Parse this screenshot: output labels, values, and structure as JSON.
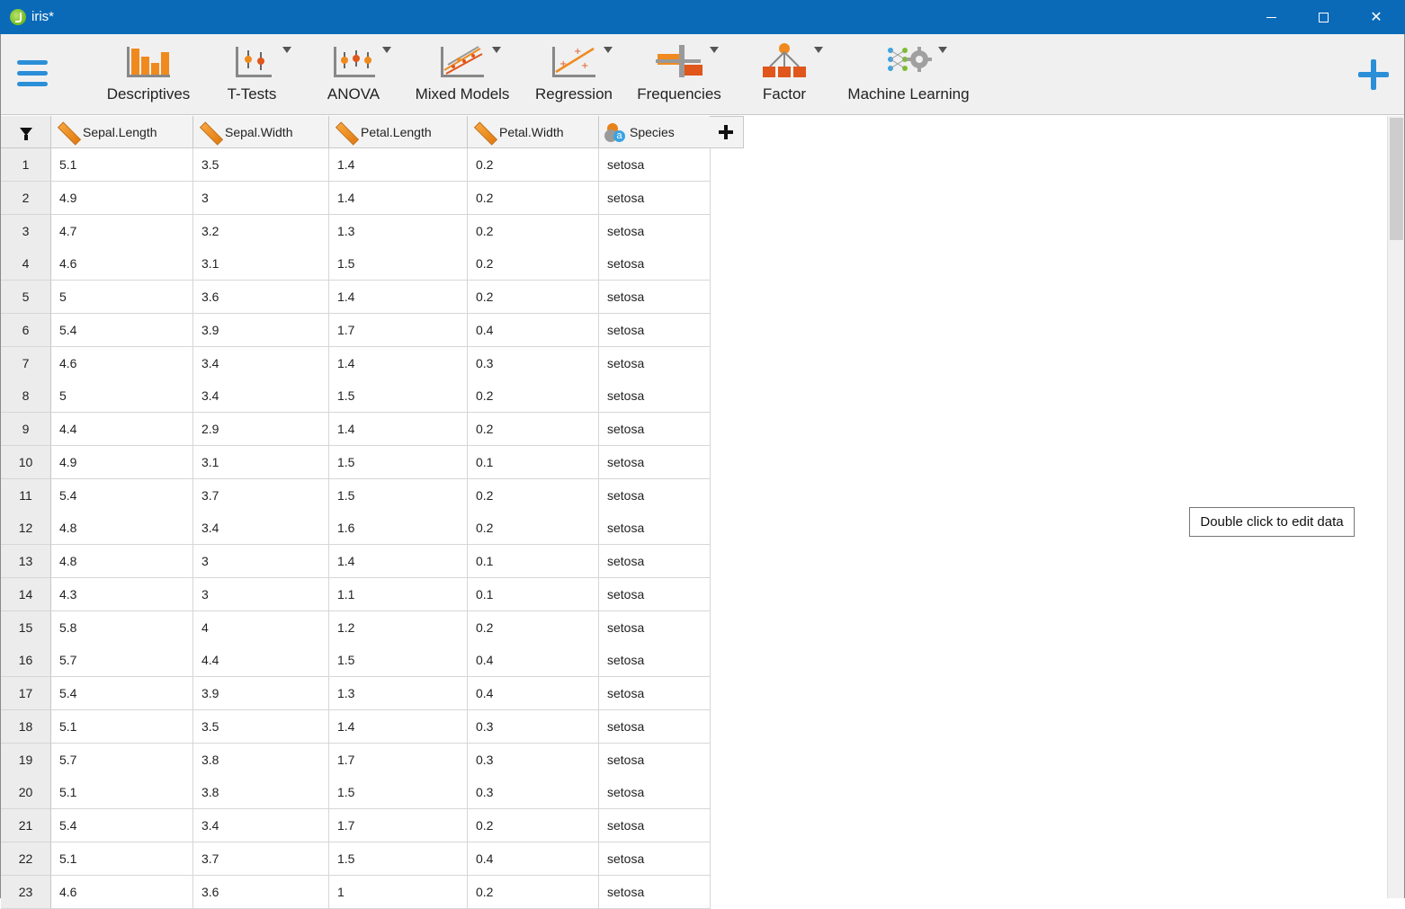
{
  "window": {
    "title": "iris*",
    "minimize_icon": "minimize-icon",
    "maximize_icon": "maximize-icon",
    "close_icon": "close-icon",
    "close_glyph": "✕"
  },
  "ribbon": {
    "menu_icon": "hamburger-menu-icon",
    "add_module_icon": "plus-icon",
    "tools": [
      {
        "label": "Descriptives",
        "icon": "descriptives-icon",
        "has_dropdown": false
      },
      {
        "label": "T-Tests",
        "icon": "t-tests-icon",
        "has_dropdown": true
      },
      {
        "label": "ANOVA",
        "icon": "anova-icon",
        "has_dropdown": true
      },
      {
        "label": "Mixed Models",
        "icon": "mixed-models-icon",
        "has_dropdown": true
      },
      {
        "label": "Regression",
        "icon": "regression-icon",
        "has_dropdown": true
      },
      {
        "label": "Frequencies",
        "icon": "frequencies-icon",
        "has_dropdown": true
      },
      {
        "label": "Factor",
        "icon": "factor-icon",
        "has_dropdown": true
      },
      {
        "label": "Machine Learning",
        "icon": "machine-learning-icon",
        "has_dropdown": true
      }
    ]
  },
  "grid": {
    "filter_icon": "filter-icon",
    "columns": [
      {
        "name": "Sepal.Length",
        "type_icon": "scale-ruler-icon"
      },
      {
        "name": "Sepal.Width",
        "type_icon": "scale-ruler-icon"
      },
      {
        "name": "Petal.Length",
        "type_icon": "scale-ruler-icon"
      },
      {
        "name": "Petal.Width",
        "type_icon": "scale-ruler-icon"
      },
      {
        "name": "Species",
        "type_icon": "nominal-text-icon"
      }
    ],
    "nominal_glyph": "a",
    "rows": [
      [
        "1",
        "5.1",
        "3.5",
        "1.4",
        "0.2",
        "setosa"
      ],
      [
        "2",
        "4.9",
        "3",
        "1.4",
        "0.2",
        "setosa"
      ],
      [
        "3",
        "4.7",
        "3.2",
        "1.3",
        "0.2",
        "setosa"
      ],
      [
        "4",
        "4.6",
        "3.1",
        "1.5",
        "0.2",
        "setosa"
      ],
      [
        "5",
        "5",
        "3.6",
        "1.4",
        "0.2",
        "setosa"
      ],
      [
        "6",
        "5.4",
        "3.9",
        "1.7",
        "0.4",
        "setosa"
      ],
      [
        "7",
        "4.6",
        "3.4",
        "1.4",
        "0.3",
        "setosa"
      ],
      [
        "8",
        "5",
        "3.4",
        "1.5",
        "0.2",
        "setosa"
      ],
      [
        "9",
        "4.4",
        "2.9",
        "1.4",
        "0.2",
        "setosa"
      ],
      [
        "10",
        "4.9",
        "3.1",
        "1.5",
        "0.1",
        "setosa"
      ],
      [
        "11",
        "5.4",
        "3.7",
        "1.5",
        "0.2",
        "setosa"
      ],
      [
        "12",
        "4.8",
        "3.4",
        "1.6",
        "0.2",
        "setosa"
      ],
      [
        "13",
        "4.8",
        "3",
        "1.4",
        "0.1",
        "setosa"
      ],
      [
        "14",
        "4.3",
        "3",
        "1.1",
        "0.1",
        "setosa"
      ],
      [
        "15",
        "5.8",
        "4",
        "1.2",
        "0.2",
        "setosa"
      ],
      [
        "16",
        "5.7",
        "4.4",
        "1.5",
        "0.4",
        "setosa"
      ],
      [
        "17",
        "5.4",
        "3.9",
        "1.3",
        "0.4",
        "setosa"
      ],
      [
        "18",
        "5.1",
        "3.5",
        "1.4",
        "0.3",
        "setosa"
      ],
      [
        "19",
        "5.7",
        "3.8",
        "1.7",
        "0.3",
        "setosa"
      ],
      [
        "20",
        "5.1",
        "3.8",
        "1.5",
        "0.3",
        "setosa"
      ],
      [
        "21",
        "5.4",
        "3.4",
        "1.7",
        "0.2",
        "setosa"
      ],
      [
        "22",
        "5.1",
        "3.7",
        "1.5",
        "0.4",
        "setosa"
      ],
      [
        "23",
        "4.6",
        "3.6",
        "1",
        "0.2",
        "setosa"
      ]
    ]
  },
  "tooltip": {
    "text": "Double click to edit data"
  },
  "colors": {
    "titlebar": "#0a6ab8",
    "accent": "#2b8fd8",
    "icon_orange": "#e37d11"
  }
}
